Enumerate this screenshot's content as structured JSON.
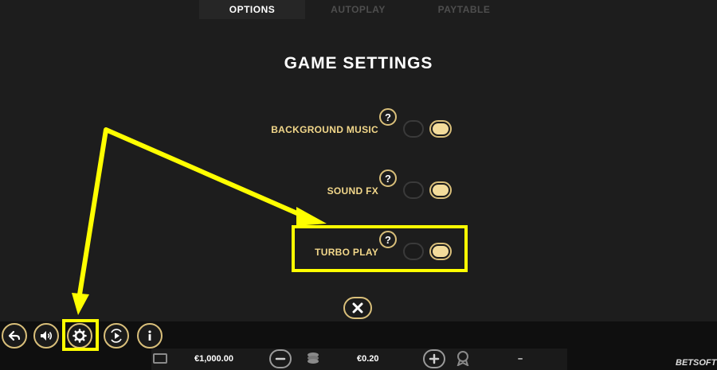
{
  "tabs": [
    {
      "label": "OPTIONS",
      "active": true
    },
    {
      "label": "AUTOPLAY",
      "active": false
    },
    {
      "label": "PAYTABLE",
      "active": false
    }
  ],
  "title": "GAME SETTINGS",
  "settings": [
    {
      "label": "BACKGROUND MUSIC",
      "help": "?",
      "enabled": true
    },
    {
      "label": "SOUND FX",
      "help": "?",
      "enabled": true
    },
    {
      "label": "TURBO PLAY",
      "help": "?",
      "enabled": true
    }
  ],
  "controls": {
    "icons": [
      "back-arrow-icon",
      "speaker-icon",
      "gear-icon",
      "autoplay-icon",
      "info-icon"
    ]
  },
  "status": {
    "balance": "€1,000.00",
    "bet": "€0.20",
    "win": "–"
  },
  "brand": "BETSOFT",
  "colors": {
    "accent": "#d9bf7a",
    "highlight": "#ffff00",
    "background": "#1d1d1d"
  }
}
